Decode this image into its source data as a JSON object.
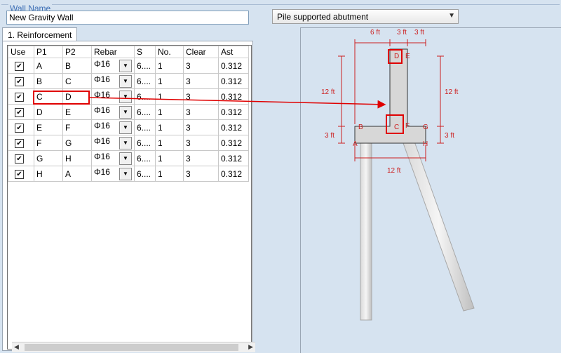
{
  "group_label": "Wall Name",
  "wall_name_value": "New Gravity Wall",
  "wall_type_selected": "Pile supported abutment",
  "tab_label": "1. Reinforcement",
  "grid": {
    "headers": [
      "Use",
      "P1",
      "P2",
      "Rebar",
      "S",
      "No.",
      "Clear",
      "Ast"
    ],
    "rows": [
      {
        "use": true,
        "p1": "A",
        "p2": "B",
        "rebar": "Φ16",
        "s": "6....",
        "no": "1",
        "clear": "3",
        "ast": "0.312"
      },
      {
        "use": true,
        "p1": "B",
        "p2": "C",
        "rebar": "Φ16",
        "s": "6....",
        "no": "1",
        "clear": "3",
        "ast": "0.312"
      },
      {
        "use": true,
        "p1": "C",
        "p2": "D",
        "rebar": "Φ16",
        "s": "6....",
        "no": "1",
        "clear": "3",
        "ast": "0.312"
      },
      {
        "use": true,
        "p1": "D",
        "p2": "E",
        "rebar": "Φ16",
        "s": "6....",
        "no": "1",
        "clear": "3",
        "ast": "0.312"
      },
      {
        "use": true,
        "p1": "E",
        "p2": "F",
        "rebar": "Φ16",
        "s": "6....",
        "no": "1",
        "clear": "3",
        "ast": "0.312"
      },
      {
        "use": true,
        "p1": "F",
        "p2": "G",
        "rebar": "Φ16",
        "s": "6....",
        "no": "1",
        "clear": "3",
        "ast": "0.312"
      },
      {
        "use": true,
        "p1": "G",
        "p2": "H",
        "rebar": "Φ16",
        "s": "6....",
        "no": "1",
        "clear": "3",
        "ast": "0.312"
      },
      {
        "use": true,
        "p1": "H",
        "p2": "A",
        "rebar": "Φ16",
        "s": "6....",
        "no": "1",
        "clear": "3",
        "ast": "0.312"
      }
    ],
    "highlighted_row": 2
  },
  "diagram": {
    "dims": {
      "top_left": "6 ft",
      "top_mid": "3 ft",
      "top_right": "3 ft",
      "left_stem": "12 ft",
      "right_stem": "12 ft",
      "left_base": "3 ft",
      "right_base": "3 ft",
      "bottom": "12 ft"
    },
    "points": {
      "A": "A",
      "B": "B",
      "C": "C",
      "D": "D",
      "E": "E",
      "F": "F",
      "G": "G",
      "H": "H"
    }
  },
  "colors": {
    "dimension": "#cc1f1f",
    "highlight": "#e00000",
    "background": "#d6e3f0"
  }
}
